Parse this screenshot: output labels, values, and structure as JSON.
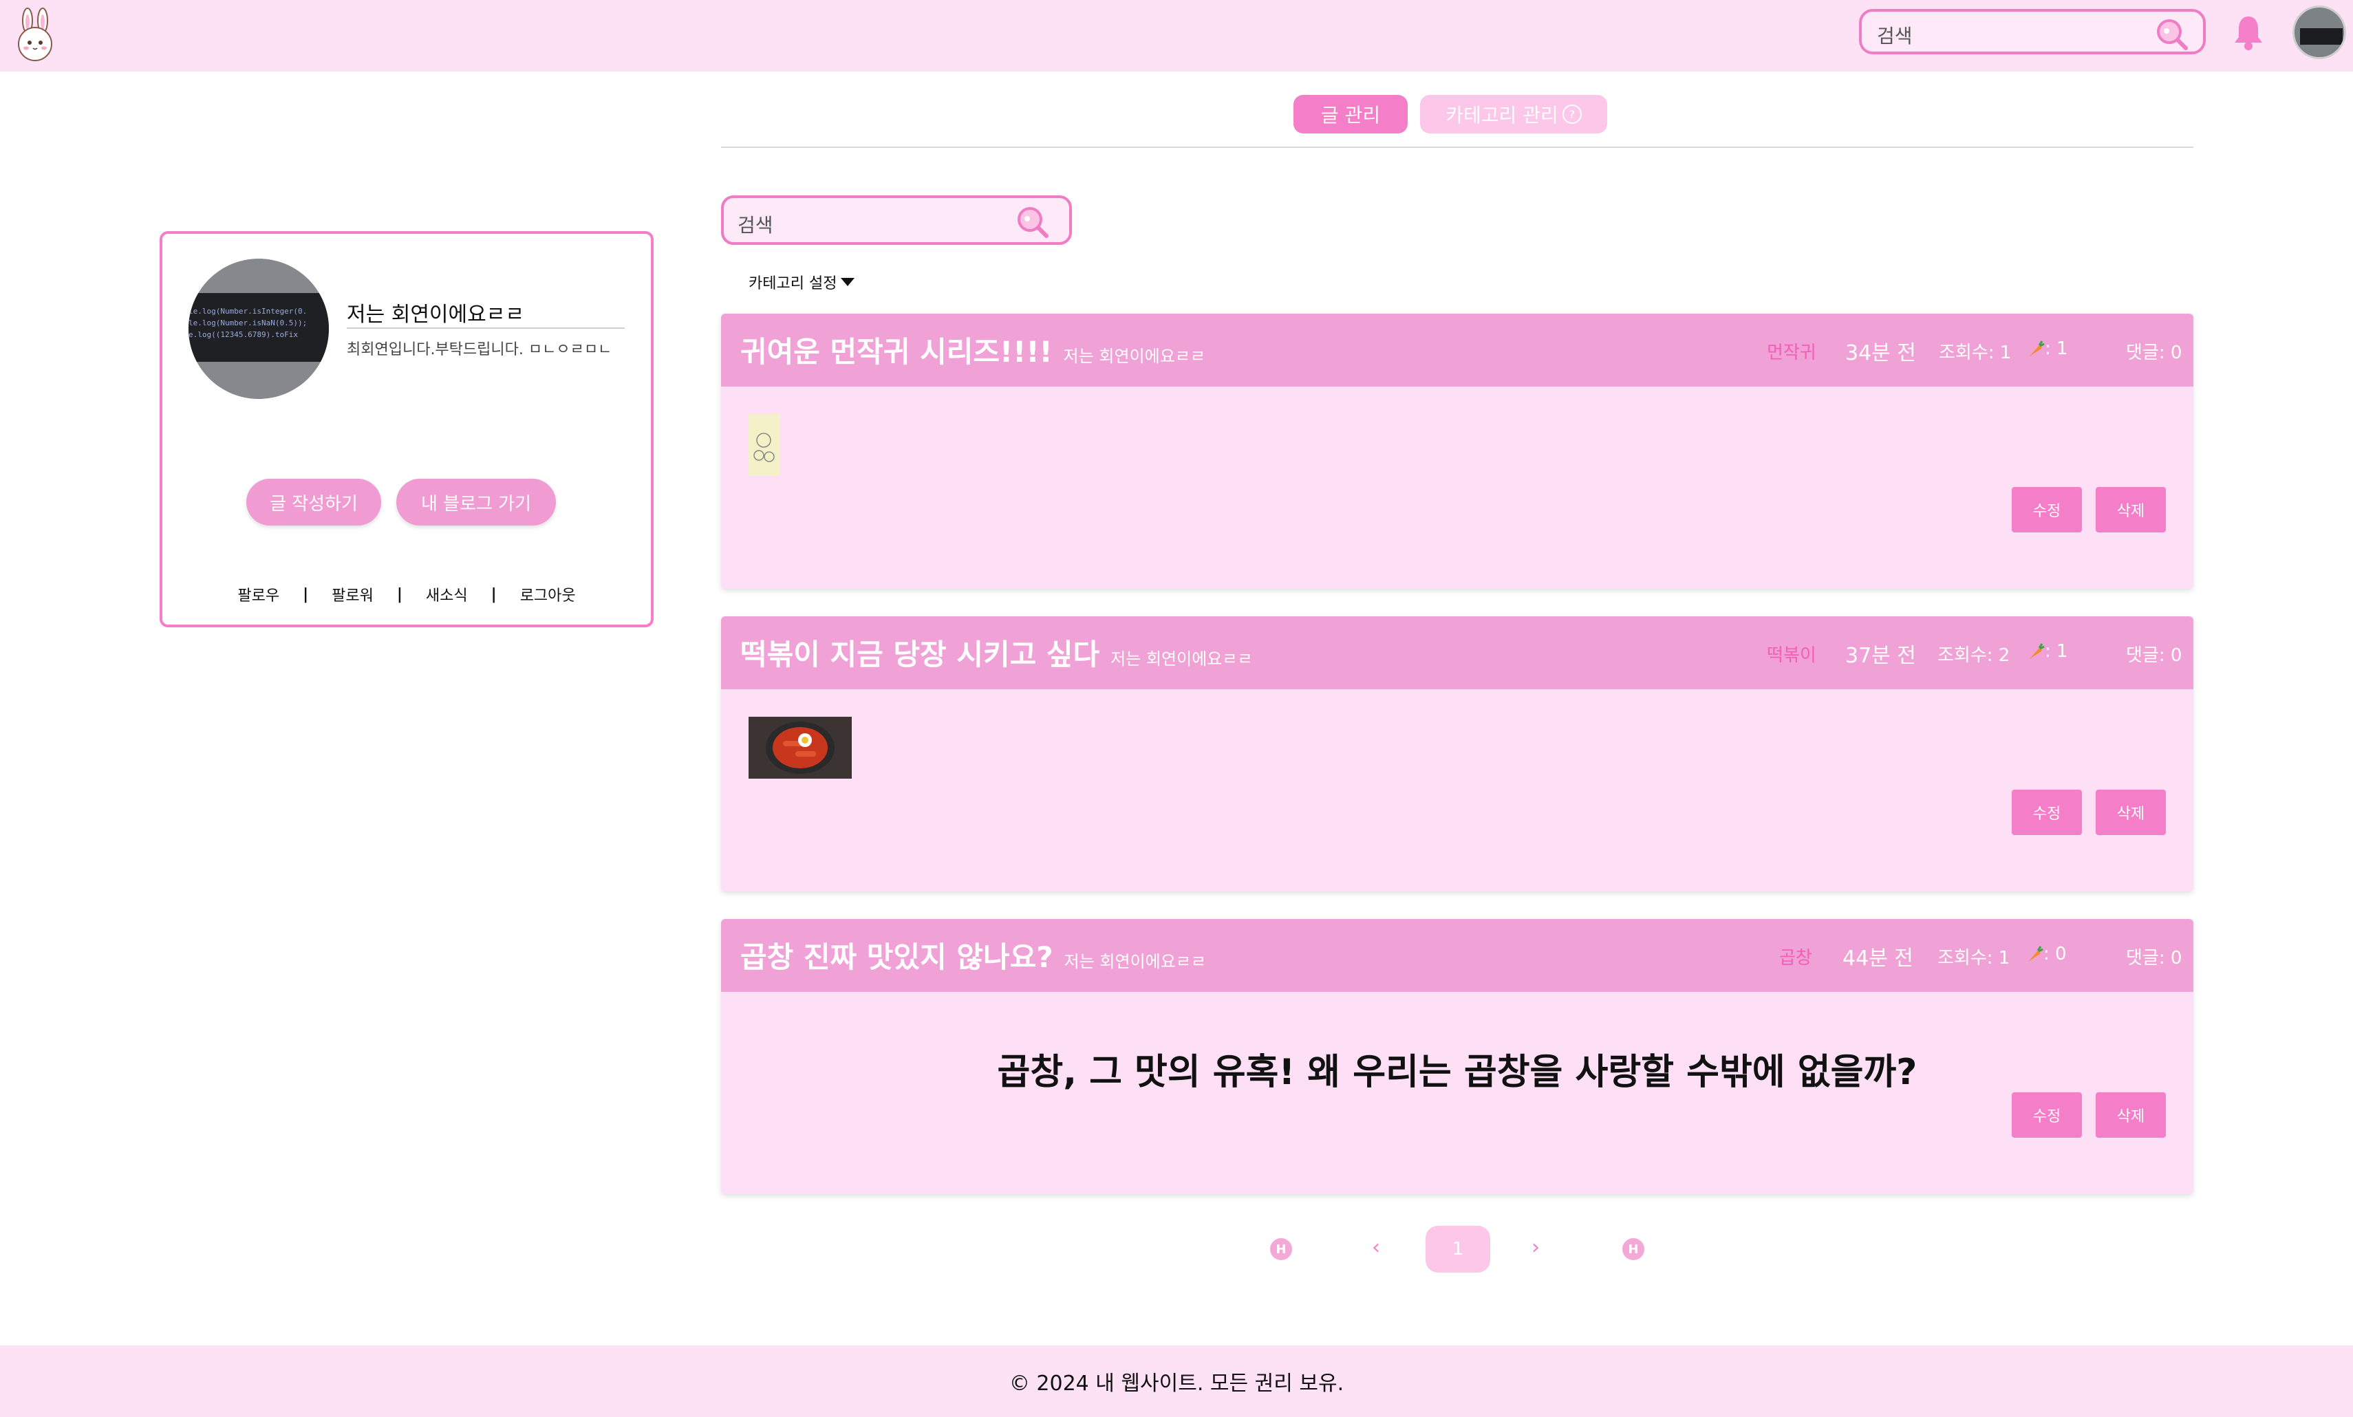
{
  "header": {
    "search_placeholder": "검색"
  },
  "tabs": {
    "posts_label": "글 관리",
    "category_label": "카테고리 관리",
    "help_glyph": "?"
  },
  "profile": {
    "name": "저는 회연이에요ㄹㄹ",
    "bio": "최회연입니다.부탁드립니다. ㅁㄴㅇㄹㅁㄴ",
    "avatar_code_lines": [
      "le.log(Number.isInteger(0.",
      "le.log(Number.isNaN(0.5));",
      "e.log((12345.6789).toFix"
    ],
    "write_button": "글 작성하기",
    "blog_button": "내 블로그 가기",
    "links": [
      "팔로우",
      "팔로워",
      "새소식",
      "로그아웃"
    ]
  },
  "content": {
    "search_placeholder": "검색",
    "category_setting": "카테고리 설정"
  },
  "posts": [
    {
      "title": "귀여운 먼작귀 시리즈!!!!",
      "author": "저는 회연이에요ㄹㄹ",
      "category": "먼작귀",
      "time": "34분 전",
      "views": "조회수: 1",
      "likes": ": 1",
      "comments": "댓글: 0",
      "edit": "수정",
      "delete": "삭제"
    },
    {
      "title": "떡볶이 지금 당장 시키고 싶다",
      "author": "저는 회연이에요ㄹㄹ",
      "category": "떡볶이",
      "time": "37분 전",
      "views": "조회수: 2",
      "likes": ": 1",
      "comments": "댓글: 0",
      "edit": "수정",
      "delete": "삭제"
    },
    {
      "title": "곱창 진짜 맛있지 않나요?",
      "author": "저는 회연이에요ㄹㄹ",
      "category": "곱창",
      "time": "44분 전",
      "views": "조회수: 1",
      "likes": ": 0",
      "comments": "댓글: 0",
      "body": "곱창, 그 맛의 유혹! 왜 우리는 곱창을 사랑할 수밖에 없을까?",
      "edit": "수정",
      "delete": "삭제"
    }
  ],
  "pagination": {
    "current": "1",
    "first_glyph": "H",
    "prev_glyph": "‹",
    "next_glyph": "›",
    "last_glyph": "H"
  },
  "footer": {
    "text": "© 2024 내 웹사이트. 모든 권리 보유."
  },
  "colors": {
    "accent": "#f47ec8",
    "header_bg": "#fde1f5",
    "card_head": "#f0a2d7",
    "card_body": "#fde0f5"
  }
}
